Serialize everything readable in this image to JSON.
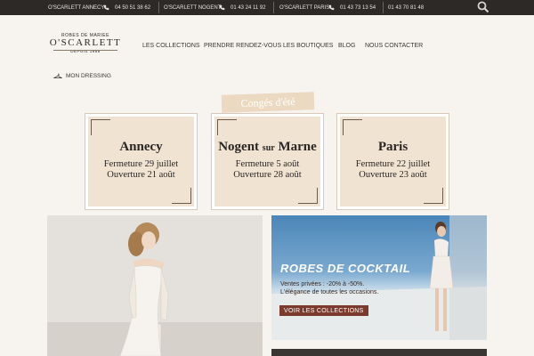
{
  "topbar": {
    "shops": [
      {
        "name": "O'SCARLETT ANNECY",
        "phones": [
          "04 50 51 38 62"
        ]
      },
      {
        "name": "O'SCARLETT NOGENT",
        "phones": [
          "01 43 24 11 92"
        ]
      },
      {
        "name": "O'SCARLETT PARIS",
        "phones": [
          "01 43 73 13 54",
          "01 43 70 81 48"
        ]
      }
    ]
  },
  "logo": {
    "tagline": "ROBES DE MARIEE",
    "name": "O'SCARLETT",
    "since": "DEPUIS 1988"
  },
  "nav": {
    "items": [
      "LES COLLECTIONS",
      "PRENDRE RENDEZ-VOUS",
      "LES BOUTIQUES",
      "BLOG",
      "NOUS CONTACTER"
    ]
  },
  "dressing": {
    "label": "MON DRESSING"
  },
  "banner": {
    "title": "Congés d'été"
  },
  "cards": [
    {
      "city": "Annecy",
      "closing": "Fermeture 29 juillet",
      "opening": "Ouverture 21 août"
    },
    {
      "city_part1": "Nogent",
      "city_small": "sur",
      "city_part2": "Marne",
      "closing": "Fermeture 5 août",
      "opening": "Ouverture 28 août"
    },
    {
      "city": "Paris",
      "closing": "Fermeture 22 juillet",
      "opening": "Ouverture 23 août"
    }
  ],
  "promo": {
    "title": "ROBES DE COCKTAIL",
    "line1": "Ventes privées : -20% à -50%.",
    "line2": "L'élégance de toutes les occasions.",
    "button": "VOIR LES COLLECTIONS"
  },
  "colors": {
    "topbar": "#2c2927",
    "page_bg": "#f7f3ef",
    "card_inner": "#f1e3d2",
    "banner": "#ecd9c1",
    "button": "#7b3a2c"
  }
}
